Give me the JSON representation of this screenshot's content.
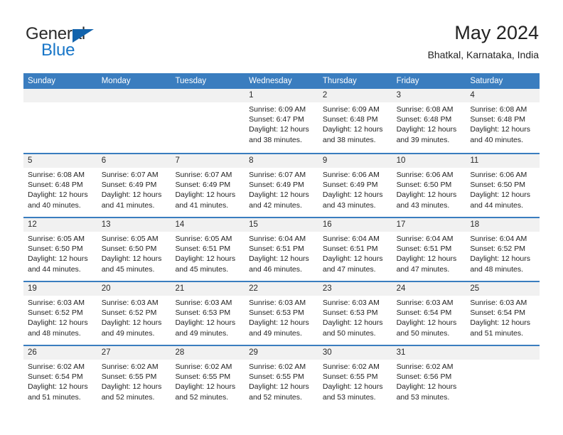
{
  "brand": {
    "name_top": "General",
    "name_bottom": "Blue",
    "accent_color": "#1876c8",
    "triangle_color": "#1263ac"
  },
  "header": {
    "title": "May 2024",
    "subtitle": "Bhatkal, Karnataka, India"
  },
  "theme": {
    "header_blue": "#3a7dbf",
    "daynum_strip": "#f1f1f1",
    "text": "#232323"
  },
  "weekday_headers": [
    "Sunday",
    "Monday",
    "Tuesday",
    "Wednesday",
    "Thursday",
    "Friday",
    "Saturday"
  ],
  "labels": {
    "sunrise_prefix": "Sunrise:",
    "sunset_prefix": "Sunset:",
    "daylight_prefix": "Daylight:"
  },
  "weeks": [
    [
      {
        "day": "",
        "empty": true
      },
      {
        "day": "",
        "empty": true
      },
      {
        "day": "",
        "empty": true
      },
      {
        "day": "1",
        "line1": "Sunrise: 6:09 AM",
        "line2": "Sunset: 6:47 PM",
        "line3": "Daylight: 12 hours and 38 minutes."
      },
      {
        "day": "2",
        "line1": "Sunrise: 6:09 AM",
        "line2": "Sunset: 6:48 PM",
        "line3": "Daylight: 12 hours and 38 minutes."
      },
      {
        "day": "3",
        "line1": "Sunrise: 6:08 AM",
        "line2": "Sunset: 6:48 PM",
        "line3": "Daylight: 12 hours and 39 minutes."
      },
      {
        "day": "4",
        "line1": "Sunrise: 6:08 AM",
        "line2": "Sunset: 6:48 PM",
        "line3": "Daylight: 12 hours and 40 minutes."
      }
    ],
    [
      {
        "day": "5",
        "line1": "Sunrise: 6:08 AM",
        "line2": "Sunset: 6:48 PM",
        "line3": "Daylight: 12 hours and 40 minutes."
      },
      {
        "day": "6",
        "line1": "Sunrise: 6:07 AM",
        "line2": "Sunset: 6:49 PM",
        "line3": "Daylight: 12 hours and 41 minutes."
      },
      {
        "day": "7",
        "line1": "Sunrise: 6:07 AM",
        "line2": "Sunset: 6:49 PM",
        "line3": "Daylight: 12 hours and 41 minutes."
      },
      {
        "day": "8",
        "line1": "Sunrise: 6:07 AM",
        "line2": "Sunset: 6:49 PM",
        "line3": "Daylight: 12 hours and 42 minutes."
      },
      {
        "day": "9",
        "line1": "Sunrise: 6:06 AM",
        "line2": "Sunset: 6:49 PM",
        "line3": "Daylight: 12 hours and 43 minutes."
      },
      {
        "day": "10",
        "line1": "Sunrise: 6:06 AM",
        "line2": "Sunset: 6:50 PM",
        "line3": "Daylight: 12 hours and 43 minutes."
      },
      {
        "day": "11",
        "line1": "Sunrise: 6:06 AM",
        "line2": "Sunset: 6:50 PM",
        "line3": "Daylight: 12 hours and 44 minutes."
      }
    ],
    [
      {
        "day": "12",
        "line1": "Sunrise: 6:05 AM",
        "line2": "Sunset: 6:50 PM",
        "line3": "Daylight: 12 hours and 44 minutes."
      },
      {
        "day": "13",
        "line1": "Sunrise: 6:05 AM",
        "line2": "Sunset: 6:50 PM",
        "line3": "Daylight: 12 hours and 45 minutes."
      },
      {
        "day": "14",
        "line1": "Sunrise: 6:05 AM",
        "line2": "Sunset: 6:51 PM",
        "line3": "Daylight: 12 hours and 45 minutes."
      },
      {
        "day": "15",
        "line1": "Sunrise: 6:04 AM",
        "line2": "Sunset: 6:51 PM",
        "line3": "Daylight: 12 hours and 46 minutes."
      },
      {
        "day": "16",
        "line1": "Sunrise: 6:04 AM",
        "line2": "Sunset: 6:51 PM",
        "line3": "Daylight: 12 hours and 47 minutes."
      },
      {
        "day": "17",
        "line1": "Sunrise: 6:04 AM",
        "line2": "Sunset: 6:51 PM",
        "line3": "Daylight: 12 hours and 47 minutes."
      },
      {
        "day": "18",
        "line1": "Sunrise: 6:04 AM",
        "line2": "Sunset: 6:52 PM",
        "line3": "Daylight: 12 hours and 48 minutes."
      }
    ],
    [
      {
        "day": "19",
        "line1": "Sunrise: 6:03 AM",
        "line2": "Sunset: 6:52 PM",
        "line3": "Daylight: 12 hours and 48 minutes."
      },
      {
        "day": "20",
        "line1": "Sunrise: 6:03 AM",
        "line2": "Sunset: 6:52 PM",
        "line3": "Daylight: 12 hours and 49 minutes."
      },
      {
        "day": "21",
        "line1": "Sunrise: 6:03 AM",
        "line2": "Sunset: 6:53 PM",
        "line3": "Daylight: 12 hours and 49 minutes."
      },
      {
        "day": "22",
        "line1": "Sunrise: 6:03 AM",
        "line2": "Sunset: 6:53 PM",
        "line3": "Daylight: 12 hours and 49 minutes."
      },
      {
        "day": "23",
        "line1": "Sunrise: 6:03 AM",
        "line2": "Sunset: 6:53 PM",
        "line3": "Daylight: 12 hours and 50 minutes."
      },
      {
        "day": "24",
        "line1": "Sunrise: 6:03 AM",
        "line2": "Sunset: 6:54 PM",
        "line3": "Daylight: 12 hours and 50 minutes."
      },
      {
        "day": "25",
        "line1": "Sunrise: 6:03 AM",
        "line2": "Sunset: 6:54 PM",
        "line3": "Daylight: 12 hours and 51 minutes."
      }
    ],
    [
      {
        "day": "26",
        "line1": "Sunrise: 6:02 AM",
        "line2": "Sunset: 6:54 PM",
        "line3": "Daylight: 12 hours and 51 minutes."
      },
      {
        "day": "27",
        "line1": "Sunrise: 6:02 AM",
        "line2": "Sunset: 6:55 PM",
        "line3": "Daylight: 12 hours and 52 minutes."
      },
      {
        "day": "28",
        "line1": "Sunrise: 6:02 AM",
        "line2": "Sunset: 6:55 PM",
        "line3": "Daylight: 12 hours and 52 minutes."
      },
      {
        "day": "29",
        "line1": "Sunrise: 6:02 AM",
        "line2": "Sunset: 6:55 PM",
        "line3": "Daylight: 12 hours and 52 minutes."
      },
      {
        "day": "30",
        "line1": "Sunrise: 6:02 AM",
        "line2": "Sunset: 6:55 PM",
        "line3": "Daylight: 12 hours and 53 minutes."
      },
      {
        "day": "31",
        "line1": "Sunrise: 6:02 AM",
        "line2": "Sunset: 6:56 PM",
        "line3": "Daylight: 12 hours and 53 minutes."
      },
      {
        "day": "",
        "empty": true
      }
    ]
  ]
}
